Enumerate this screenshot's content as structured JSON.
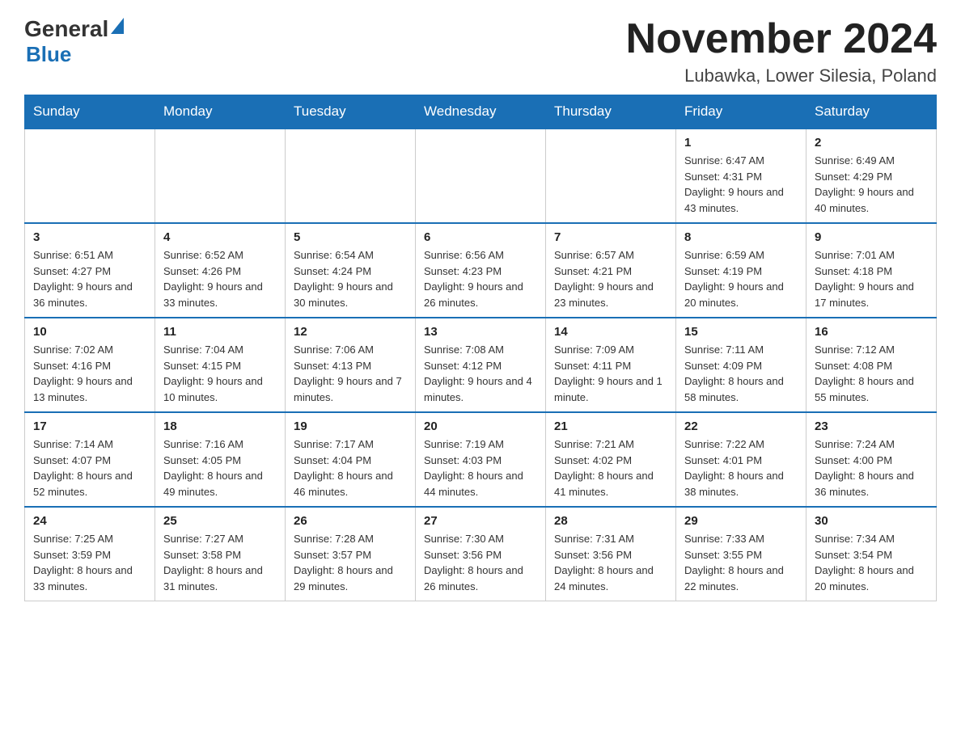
{
  "header": {
    "month_title": "November 2024",
    "location": "Lubawka, Lower Silesia, Poland"
  },
  "logo": {
    "text_general": "General",
    "text_blue": "Blue"
  },
  "weekdays": [
    "Sunday",
    "Monday",
    "Tuesday",
    "Wednesday",
    "Thursday",
    "Friday",
    "Saturday"
  ],
  "weeks": [
    [
      {
        "day": "",
        "info": ""
      },
      {
        "day": "",
        "info": ""
      },
      {
        "day": "",
        "info": ""
      },
      {
        "day": "",
        "info": ""
      },
      {
        "day": "",
        "info": ""
      },
      {
        "day": "1",
        "info": "Sunrise: 6:47 AM\nSunset: 4:31 PM\nDaylight: 9 hours and 43 minutes."
      },
      {
        "day": "2",
        "info": "Sunrise: 6:49 AM\nSunset: 4:29 PM\nDaylight: 9 hours and 40 minutes."
      }
    ],
    [
      {
        "day": "3",
        "info": "Sunrise: 6:51 AM\nSunset: 4:27 PM\nDaylight: 9 hours and 36 minutes."
      },
      {
        "day": "4",
        "info": "Sunrise: 6:52 AM\nSunset: 4:26 PM\nDaylight: 9 hours and 33 minutes."
      },
      {
        "day": "5",
        "info": "Sunrise: 6:54 AM\nSunset: 4:24 PM\nDaylight: 9 hours and 30 minutes."
      },
      {
        "day": "6",
        "info": "Sunrise: 6:56 AM\nSunset: 4:23 PM\nDaylight: 9 hours and 26 minutes."
      },
      {
        "day": "7",
        "info": "Sunrise: 6:57 AM\nSunset: 4:21 PM\nDaylight: 9 hours and 23 minutes."
      },
      {
        "day": "8",
        "info": "Sunrise: 6:59 AM\nSunset: 4:19 PM\nDaylight: 9 hours and 20 minutes."
      },
      {
        "day": "9",
        "info": "Sunrise: 7:01 AM\nSunset: 4:18 PM\nDaylight: 9 hours and 17 minutes."
      }
    ],
    [
      {
        "day": "10",
        "info": "Sunrise: 7:02 AM\nSunset: 4:16 PM\nDaylight: 9 hours and 13 minutes."
      },
      {
        "day": "11",
        "info": "Sunrise: 7:04 AM\nSunset: 4:15 PM\nDaylight: 9 hours and 10 minutes."
      },
      {
        "day": "12",
        "info": "Sunrise: 7:06 AM\nSunset: 4:13 PM\nDaylight: 9 hours and 7 minutes."
      },
      {
        "day": "13",
        "info": "Sunrise: 7:08 AM\nSunset: 4:12 PM\nDaylight: 9 hours and 4 minutes."
      },
      {
        "day": "14",
        "info": "Sunrise: 7:09 AM\nSunset: 4:11 PM\nDaylight: 9 hours and 1 minute."
      },
      {
        "day": "15",
        "info": "Sunrise: 7:11 AM\nSunset: 4:09 PM\nDaylight: 8 hours and 58 minutes."
      },
      {
        "day": "16",
        "info": "Sunrise: 7:12 AM\nSunset: 4:08 PM\nDaylight: 8 hours and 55 minutes."
      }
    ],
    [
      {
        "day": "17",
        "info": "Sunrise: 7:14 AM\nSunset: 4:07 PM\nDaylight: 8 hours and 52 minutes."
      },
      {
        "day": "18",
        "info": "Sunrise: 7:16 AM\nSunset: 4:05 PM\nDaylight: 8 hours and 49 minutes."
      },
      {
        "day": "19",
        "info": "Sunrise: 7:17 AM\nSunset: 4:04 PM\nDaylight: 8 hours and 46 minutes."
      },
      {
        "day": "20",
        "info": "Sunrise: 7:19 AM\nSunset: 4:03 PM\nDaylight: 8 hours and 44 minutes."
      },
      {
        "day": "21",
        "info": "Sunrise: 7:21 AM\nSunset: 4:02 PM\nDaylight: 8 hours and 41 minutes."
      },
      {
        "day": "22",
        "info": "Sunrise: 7:22 AM\nSunset: 4:01 PM\nDaylight: 8 hours and 38 minutes."
      },
      {
        "day": "23",
        "info": "Sunrise: 7:24 AM\nSunset: 4:00 PM\nDaylight: 8 hours and 36 minutes."
      }
    ],
    [
      {
        "day": "24",
        "info": "Sunrise: 7:25 AM\nSunset: 3:59 PM\nDaylight: 8 hours and 33 minutes."
      },
      {
        "day": "25",
        "info": "Sunrise: 7:27 AM\nSunset: 3:58 PM\nDaylight: 8 hours and 31 minutes."
      },
      {
        "day": "26",
        "info": "Sunrise: 7:28 AM\nSunset: 3:57 PM\nDaylight: 8 hours and 29 minutes."
      },
      {
        "day": "27",
        "info": "Sunrise: 7:30 AM\nSunset: 3:56 PM\nDaylight: 8 hours and 26 minutes."
      },
      {
        "day": "28",
        "info": "Sunrise: 7:31 AM\nSunset: 3:56 PM\nDaylight: 8 hours and 24 minutes."
      },
      {
        "day": "29",
        "info": "Sunrise: 7:33 AM\nSunset: 3:55 PM\nDaylight: 8 hours and 22 minutes."
      },
      {
        "day": "30",
        "info": "Sunrise: 7:34 AM\nSunset: 3:54 PM\nDaylight: 8 hours and 20 minutes."
      }
    ]
  ]
}
